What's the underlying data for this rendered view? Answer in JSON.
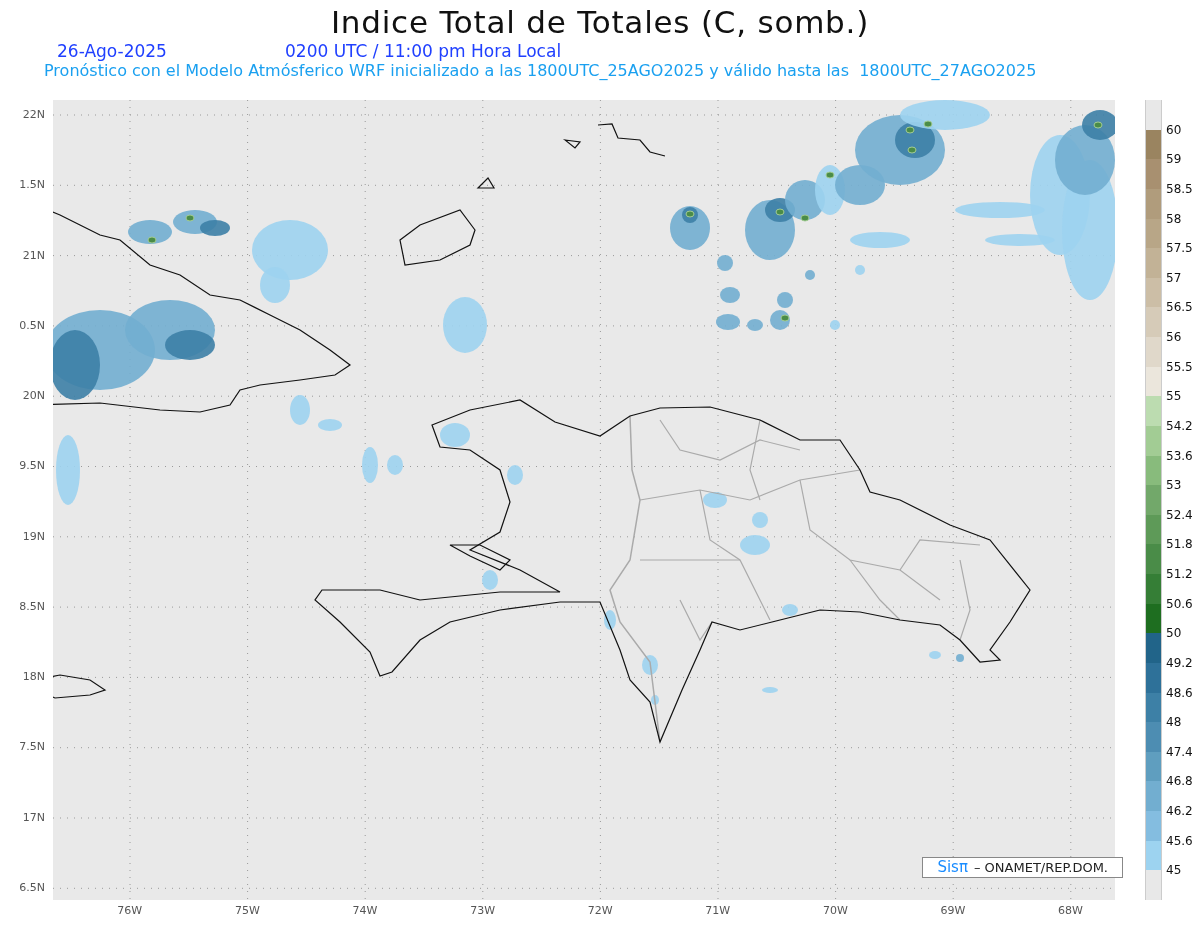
{
  "title": "Indice Total de Totales (C, somb.)",
  "date": "26-Ago-2025",
  "time": "0200 UTC / 11:00 pm Hora Local",
  "subtitle": "Pronóstico con el Modelo Atmósferico WRF inicializado a las 1800UTC_25AGO2025 y válido hasta las  1800UTC_27AGO2025",
  "y_labels": [
    "22N",
    "1.5N",
    "21N",
    "0.5N",
    "20N",
    "9.5N",
    "19N",
    "8.5N",
    "18N",
    "7.5N",
    "17N",
    "6.5N"
  ],
  "x_labels": [
    "76W",
    "75W",
    "74W",
    "73W",
    "72W",
    "71W",
    "70W",
    "69W",
    "68W"
  ],
  "credit": {
    "brand": "Sisπ",
    "text": "– ONAMET/REP.DOM."
  },
  "colorbar": {
    "steps": [
      {
        "label": "60",
        "color": "#e8e8e8"
      },
      {
        "label": "59",
        "color": "#9a8460"
      },
      {
        "label": "58.5",
        "color": "#a89070"
      },
      {
        "label": "58",
        "color": "#b09c7c"
      },
      {
        "label": "57.5",
        "color": "#b8a687"
      },
      {
        "label": "57",
        "color": "#c2b296"
      },
      {
        "label": "56.5",
        "color": "#ccbea6"
      },
      {
        "label": "56",
        "color": "#d6cbb8"
      },
      {
        "label": "55.5",
        "color": "#e0d8ca"
      },
      {
        "label": "55",
        "color": "#ebe6dc"
      },
      {
        "label": "54.2",
        "color": "#bcdcb0"
      },
      {
        "label": "53.6",
        "color": "#a2cc94"
      },
      {
        "label": "53",
        "color": "#88bb7c"
      },
      {
        "label": "52.4",
        "color": "#72a86a"
      },
      {
        "label": "51.8",
        "color": "#5e9a58"
      },
      {
        "label": "51.2",
        "color": "#4a8c48"
      },
      {
        "label": "50.6",
        "color": "#357e36"
      },
      {
        "label": "50",
        "color": "#1e6e20"
      },
      {
        "label": "49.2",
        "color": "#216489"
      },
      {
        "label": "48.6",
        "color": "#2e7199"
      },
      {
        "label": "48",
        "color": "#3d80a6"
      },
      {
        "label": "47.4",
        "color": "#4d8db2"
      },
      {
        "label": "46.8",
        "color": "#5f9ebf"
      },
      {
        "label": "46.2",
        "color": "#72aed0"
      },
      {
        "label": "45.6",
        "color": "#84bde0"
      },
      {
        "label": "45",
        "color": "#9dd3f0"
      },
      {
        "color": "#e8e8e8"
      }
    ]
  }
}
